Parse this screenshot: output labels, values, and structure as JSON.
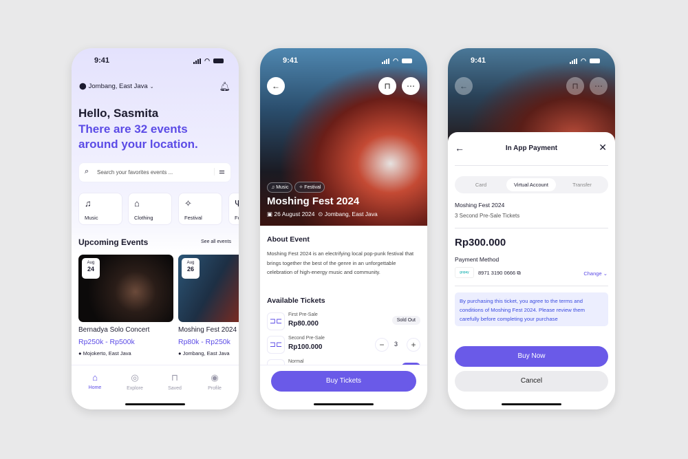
{
  "status": {
    "time": "9:41"
  },
  "home": {
    "location": "Jombang, East Java",
    "greeting": "Hello, Sasmita",
    "subtitle_1": "There are 32 events",
    "subtitle_2": "around your location.",
    "search_placeholder": "Search your favorites events ...",
    "categories": [
      {
        "label": "Music",
        "icon": "music-note-icon"
      },
      {
        "label": "Clothing",
        "icon": "shirt-icon"
      },
      {
        "label": "Festival",
        "icon": "party-popper-icon"
      },
      {
        "label": "Fo",
        "icon": "fork-icon"
      }
    ],
    "upcoming_title": "Upcoming Events",
    "see_all": "See all events",
    "events": [
      {
        "month": "Aug",
        "day": "24",
        "title": "Bernadya Solo Concert",
        "price": "Rp250k - Rp500k",
        "location": "Mojokerto, East Java"
      },
      {
        "month": "Aug",
        "day": "26",
        "title": "Moshing Fest 2024",
        "price": "Rp80k - Rp250k",
        "location": "Jombang, East Java"
      }
    ],
    "nav": [
      {
        "label": "Home",
        "icon": "home-icon"
      },
      {
        "label": "Explore",
        "icon": "compass-icon"
      },
      {
        "label": "Saved",
        "icon": "bookmark-icon"
      },
      {
        "label": "Profile",
        "icon": "profile-icon"
      }
    ]
  },
  "detail": {
    "tags": [
      "Music",
      "Festival"
    ],
    "title": "Moshing Fest 2024",
    "date": "26 August 2024",
    "location": "Jombang, East Java",
    "about_title": "About Event",
    "about": "Moshing Fest 2024 is an electrifying local pop-punk festival that brings together the best of the genre in an unforgettable celebration of high-energy music and community.",
    "tickets_title": "Available Tickets",
    "tickets": [
      {
        "name": "First Pre-Sale",
        "price": "Rp80.000",
        "status": "Sold Out"
      },
      {
        "name": "Second Pre-Sale",
        "price": "Rp100.000",
        "quantity": "3"
      },
      {
        "name": "Normal"
      }
    ],
    "buy_label": "Buy Tickets"
  },
  "payment": {
    "title": "In App Payment",
    "tabs": [
      "Card",
      "Virtual Account",
      "Transfer"
    ],
    "active_tab": "Virtual Account",
    "event": "Moshing Fest 2024",
    "ticket_summary": "3 Second Pre-Sale Tickets",
    "total": "Rp300.000",
    "method_label": "Payment Method",
    "provider": "gopay",
    "account": "8971 3190 0666",
    "change_label": "Change",
    "notice": "By purchasing this ticket, you agree to the terms and conditions of Moshing Fest 2024. Please review them carefully before completing your purchase",
    "buy_now": "Buy Now",
    "cancel": "Cancel"
  },
  "colors": {
    "accent": "#6a5ae8",
    "accent_text": "#5b4be6",
    "notice_bg": "#eceefe"
  }
}
